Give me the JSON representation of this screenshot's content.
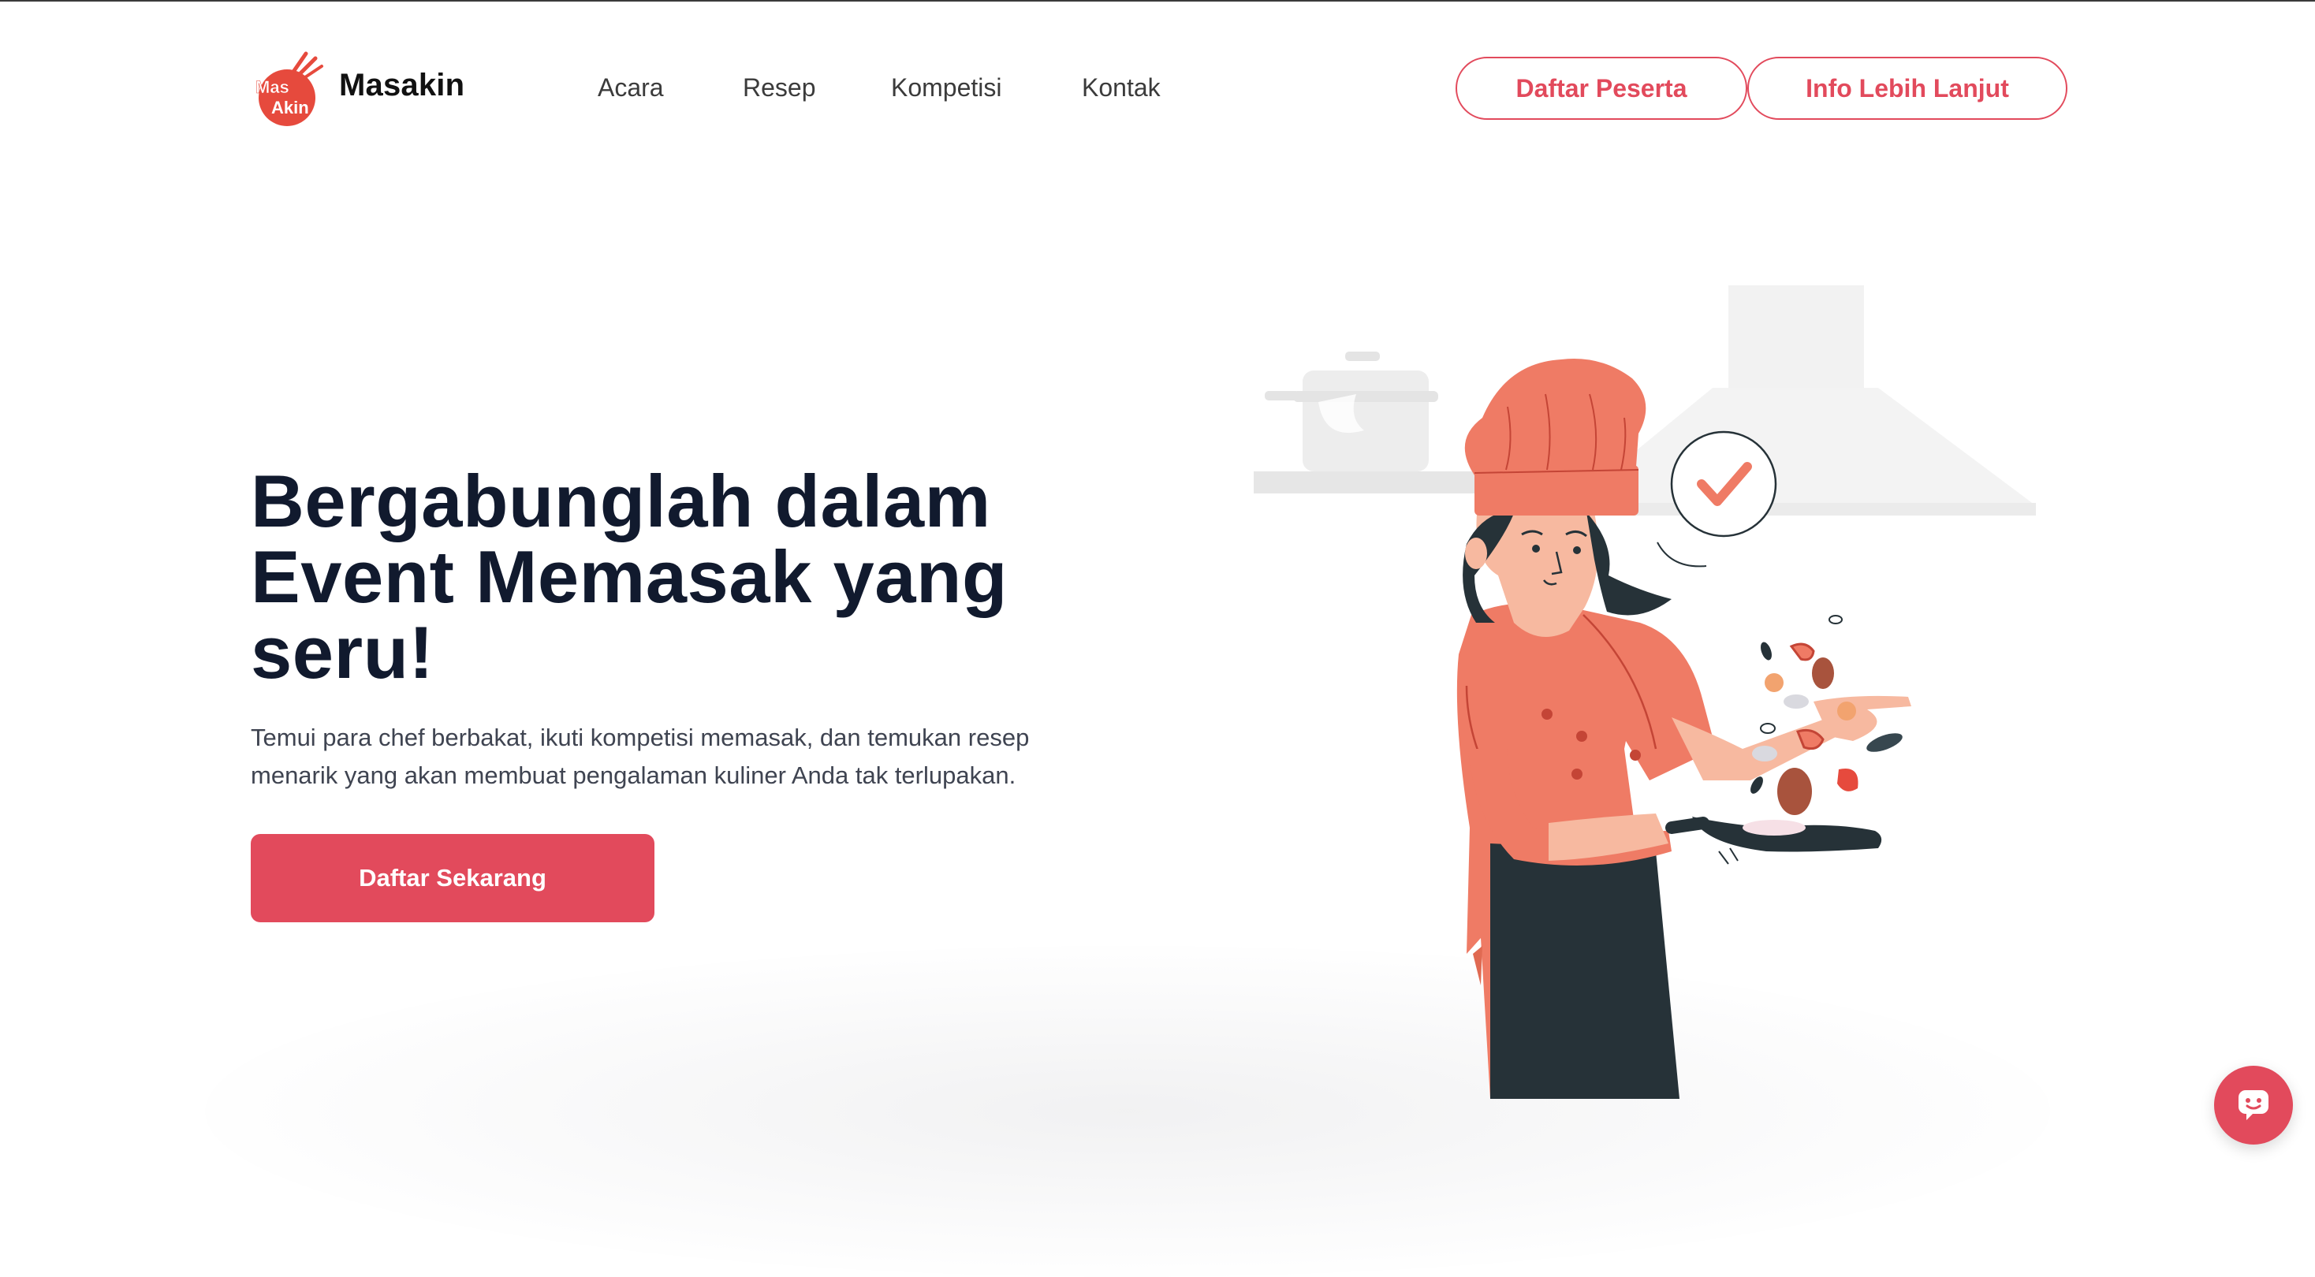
{
  "brand": {
    "name": "Masakin",
    "logo_text_top": "Mas",
    "logo_text_bottom": "Akin"
  },
  "nav": {
    "items": [
      {
        "label": "Acara"
      },
      {
        "label": "Resep"
      },
      {
        "label": "Kompetisi"
      },
      {
        "label": "Kontak"
      }
    ]
  },
  "header_actions": {
    "register_label": "Daftar Peserta",
    "info_label": "Info Lebih Lanjut"
  },
  "hero": {
    "title_line1": "Bergabunglah dalam",
    "title_line2_strong": "Event Memasak",
    "title_line2_rest": " yang",
    "title_line3": "seru!",
    "description_line1": "Temui para chef berbakat, ikuti kompetisi memasak, dan temukan resep",
    "description_line2": "menarik yang akan membuat pengalaman kuliner Anda tak terlupakan.",
    "cta_label": "Daftar Sekarang"
  },
  "illustration": {
    "icon": "chef-cooking-illustration",
    "badge_icon": "checkmark-icon"
  },
  "chat_widget": {
    "icon": "chat-bot-icon"
  },
  "colors": {
    "accent": "#e24a5c",
    "chef_orange": "#ef7b65",
    "apron_dark": "#263238",
    "title": "#111a2e"
  }
}
